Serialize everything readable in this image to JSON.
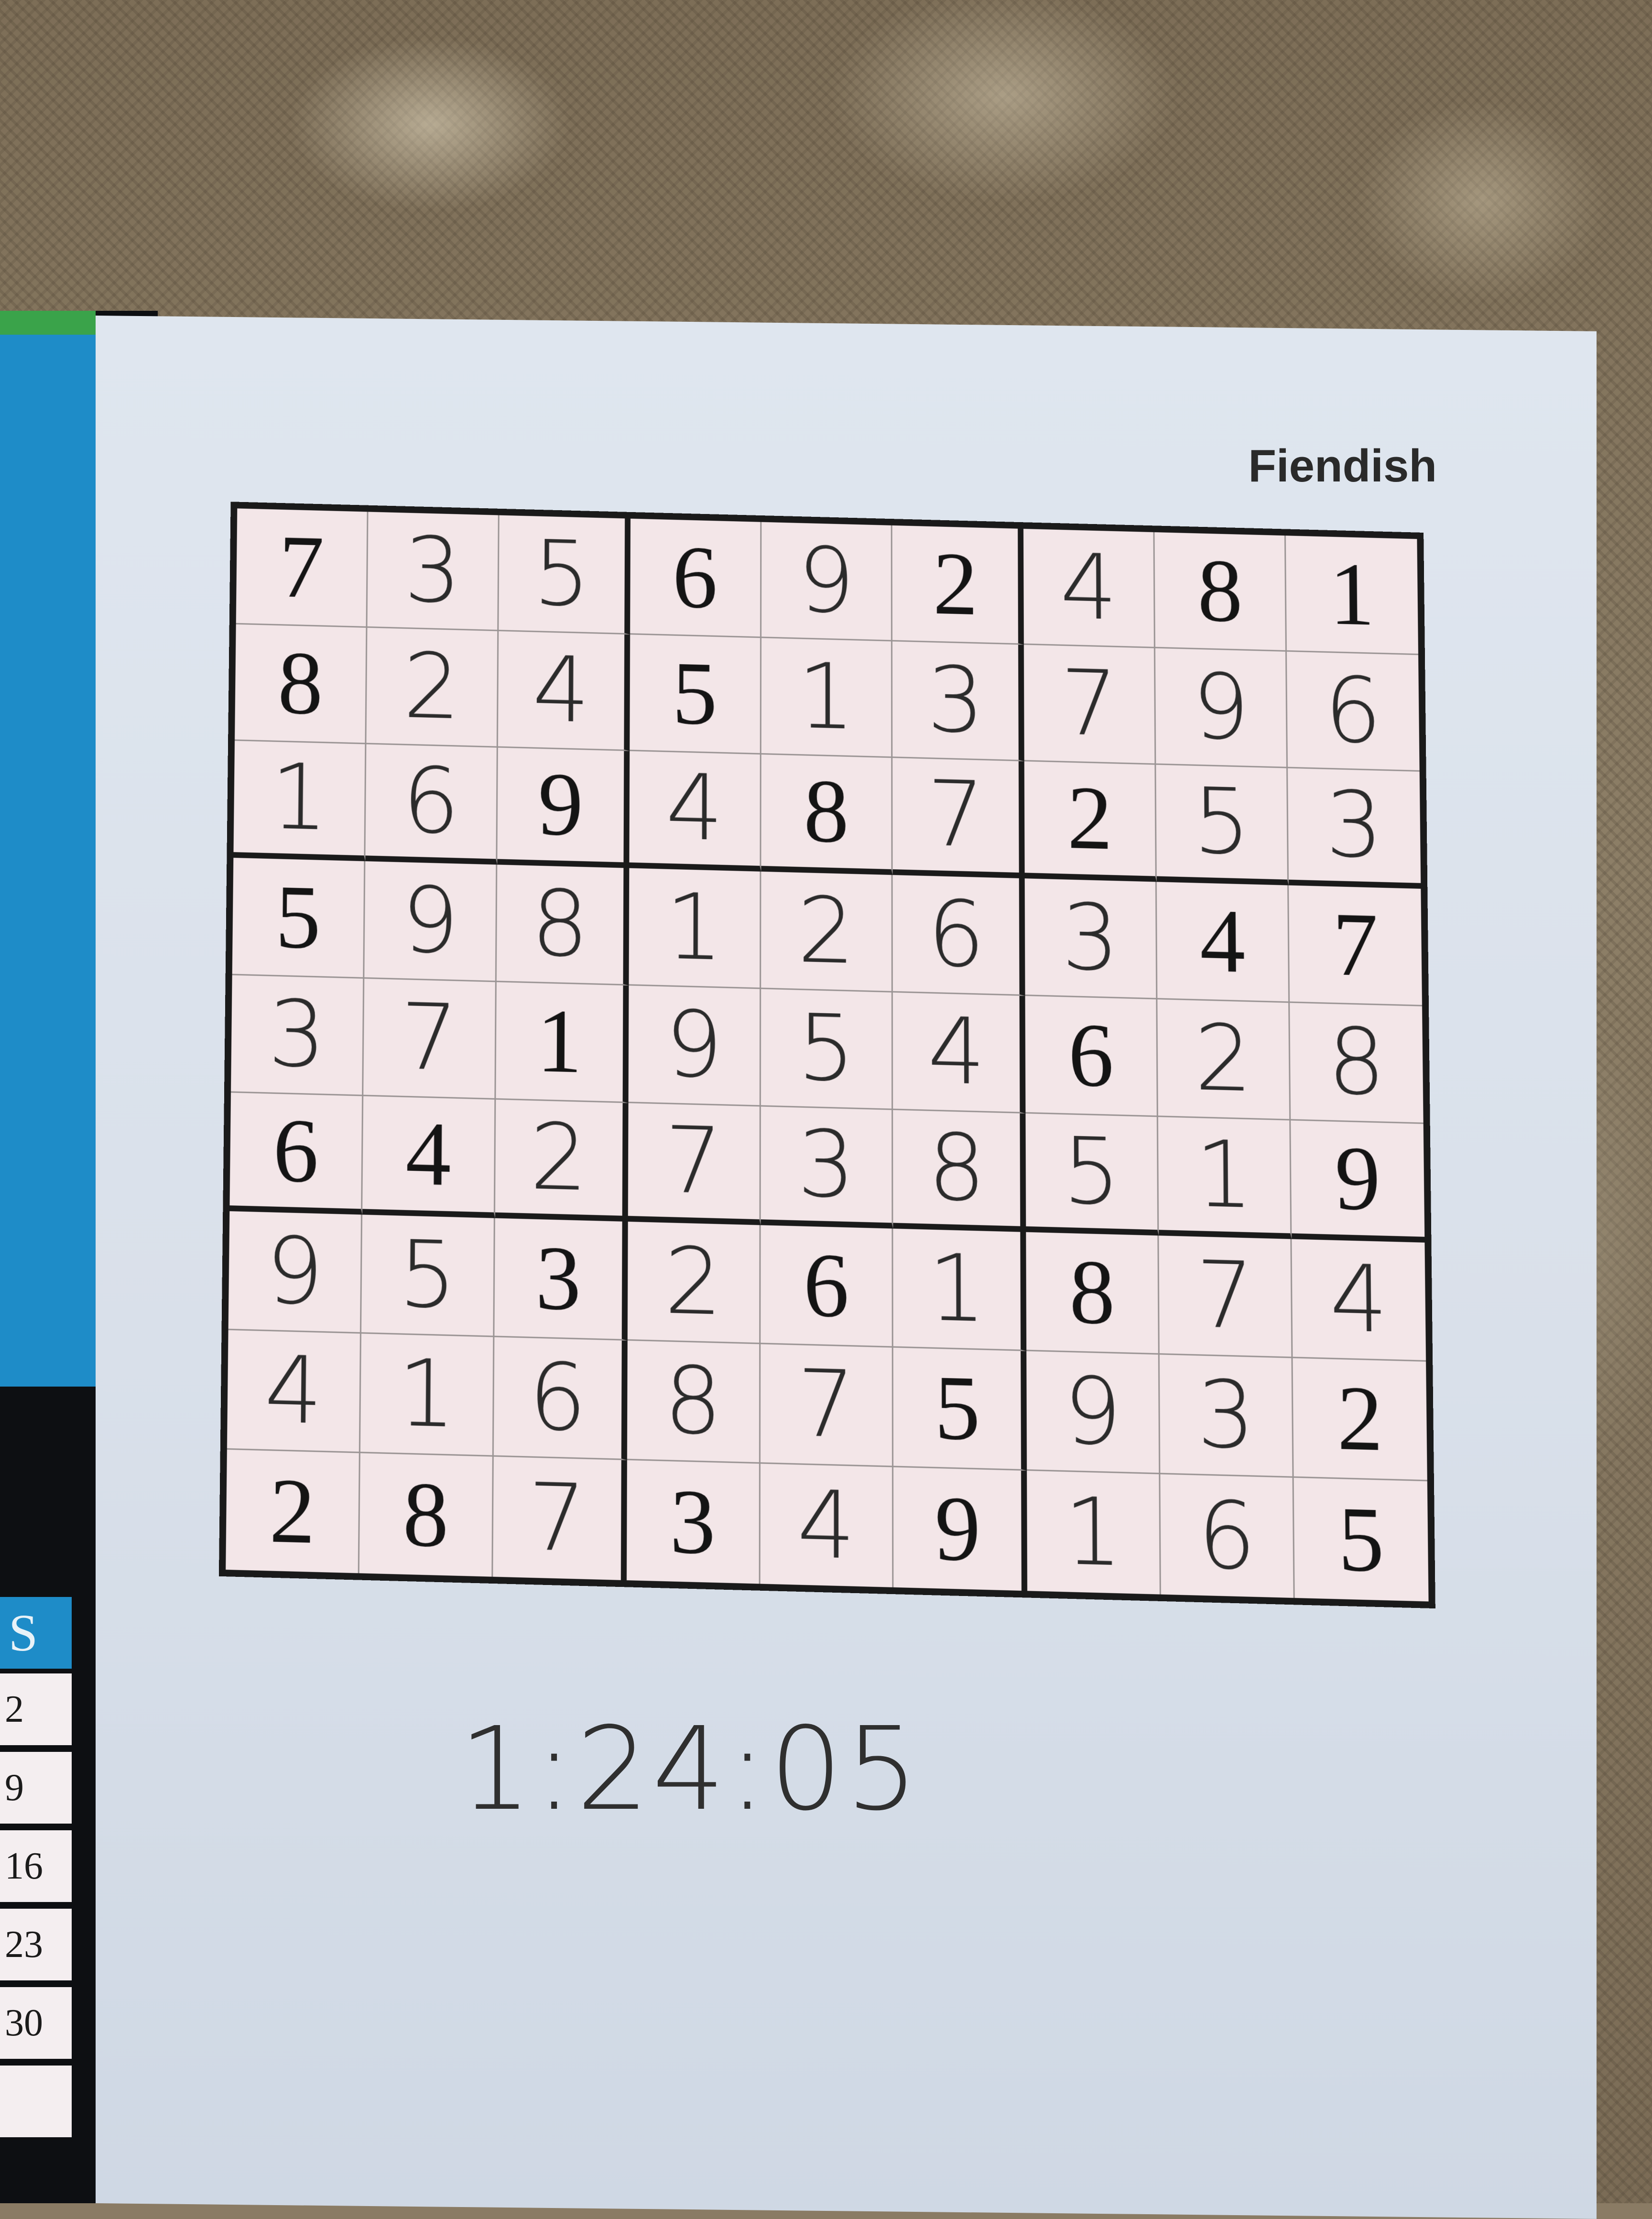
{
  "puzzle": {
    "difficulty": "Fiendish",
    "time": "1:24:05",
    "rows": [
      [
        "7",
        "3",
        "5",
        "6",
        "9",
        "2",
        "4",
        "8",
        "1"
      ],
      [
        "8",
        "2",
        "4",
        "5",
        "1",
        "3",
        "7",
        "9",
        "6"
      ],
      [
        "1",
        "6",
        "9",
        "4",
        "8",
        "7",
        "2",
        "5",
        "3"
      ],
      [
        "5",
        "9",
        "8",
        "1",
        "2",
        "6",
        "3",
        "4",
        "7"
      ],
      [
        "3",
        "7",
        "1",
        "9",
        "5",
        "4",
        "6",
        "2",
        "8"
      ],
      [
        "6",
        "4",
        "2",
        "7",
        "3",
        "8",
        "5",
        "1",
        "9"
      ],
      [
        "9",
        "5",
        "3",
        "2",
        "6",
        "1",
        "8",
        "7",
        "4"
      ],
      [
        "4",
        "1",
        "6",
        "8",
        "7",
        "5",
        "9",
        "3",
        "2"
      ],
      [
        "2",
        "8",
        "7",
        "3",
        "4",
        "9",
        "1",
        "6",
        "5"
      ]
    ],
    "given": [
      [
        1,
        0,
        0,
        1,
        0,
        1,
        0,
        1,
        1
      ],
      [
        1,
        0,
        0,
        1,
        0,
        0,
        0,
        0,
        0
      ],
      [
        0,
        0,
        1,
        0,
        1,
        0,
        1,
        0,
        0
      ],
      [
        1,
        0,
        0,
        0,
        0,
        0,
        0,
        1,
        1
      ],
      [
        0,
        0,
        1,
        0,
        0,
        0,
        1,
        0,
        0
      ],
      [
        1,
        1,
        0,
        0,
        0,
        0,
        0,
        0,
        1
      ],
      [
        0,
        0,
        1,
        0,
        1,
        0,
        1,
        0,
        0
      ],
      [
        0,
        0,
        0,
        0,
        0,
        1,
        0,
        0,
        1
      ],
      [
        1,
        1,
        0,
        1,
        0,
        1,
        0,
        0,
        1
      ]
    ]
  },
  "calendar": {
    "day_header": "S",
    "dates": [
      "2",
      "9",
      "16",
      "23",
      "30",
      ""
    ]
  },
  "colors": {
    "calendar_blue": "#1e8cc8",
    "calendar_green": "#3aa34a",
    "paper": "#dfe6ef",
    "grid_line": "#1a1a1a"
  }
}
